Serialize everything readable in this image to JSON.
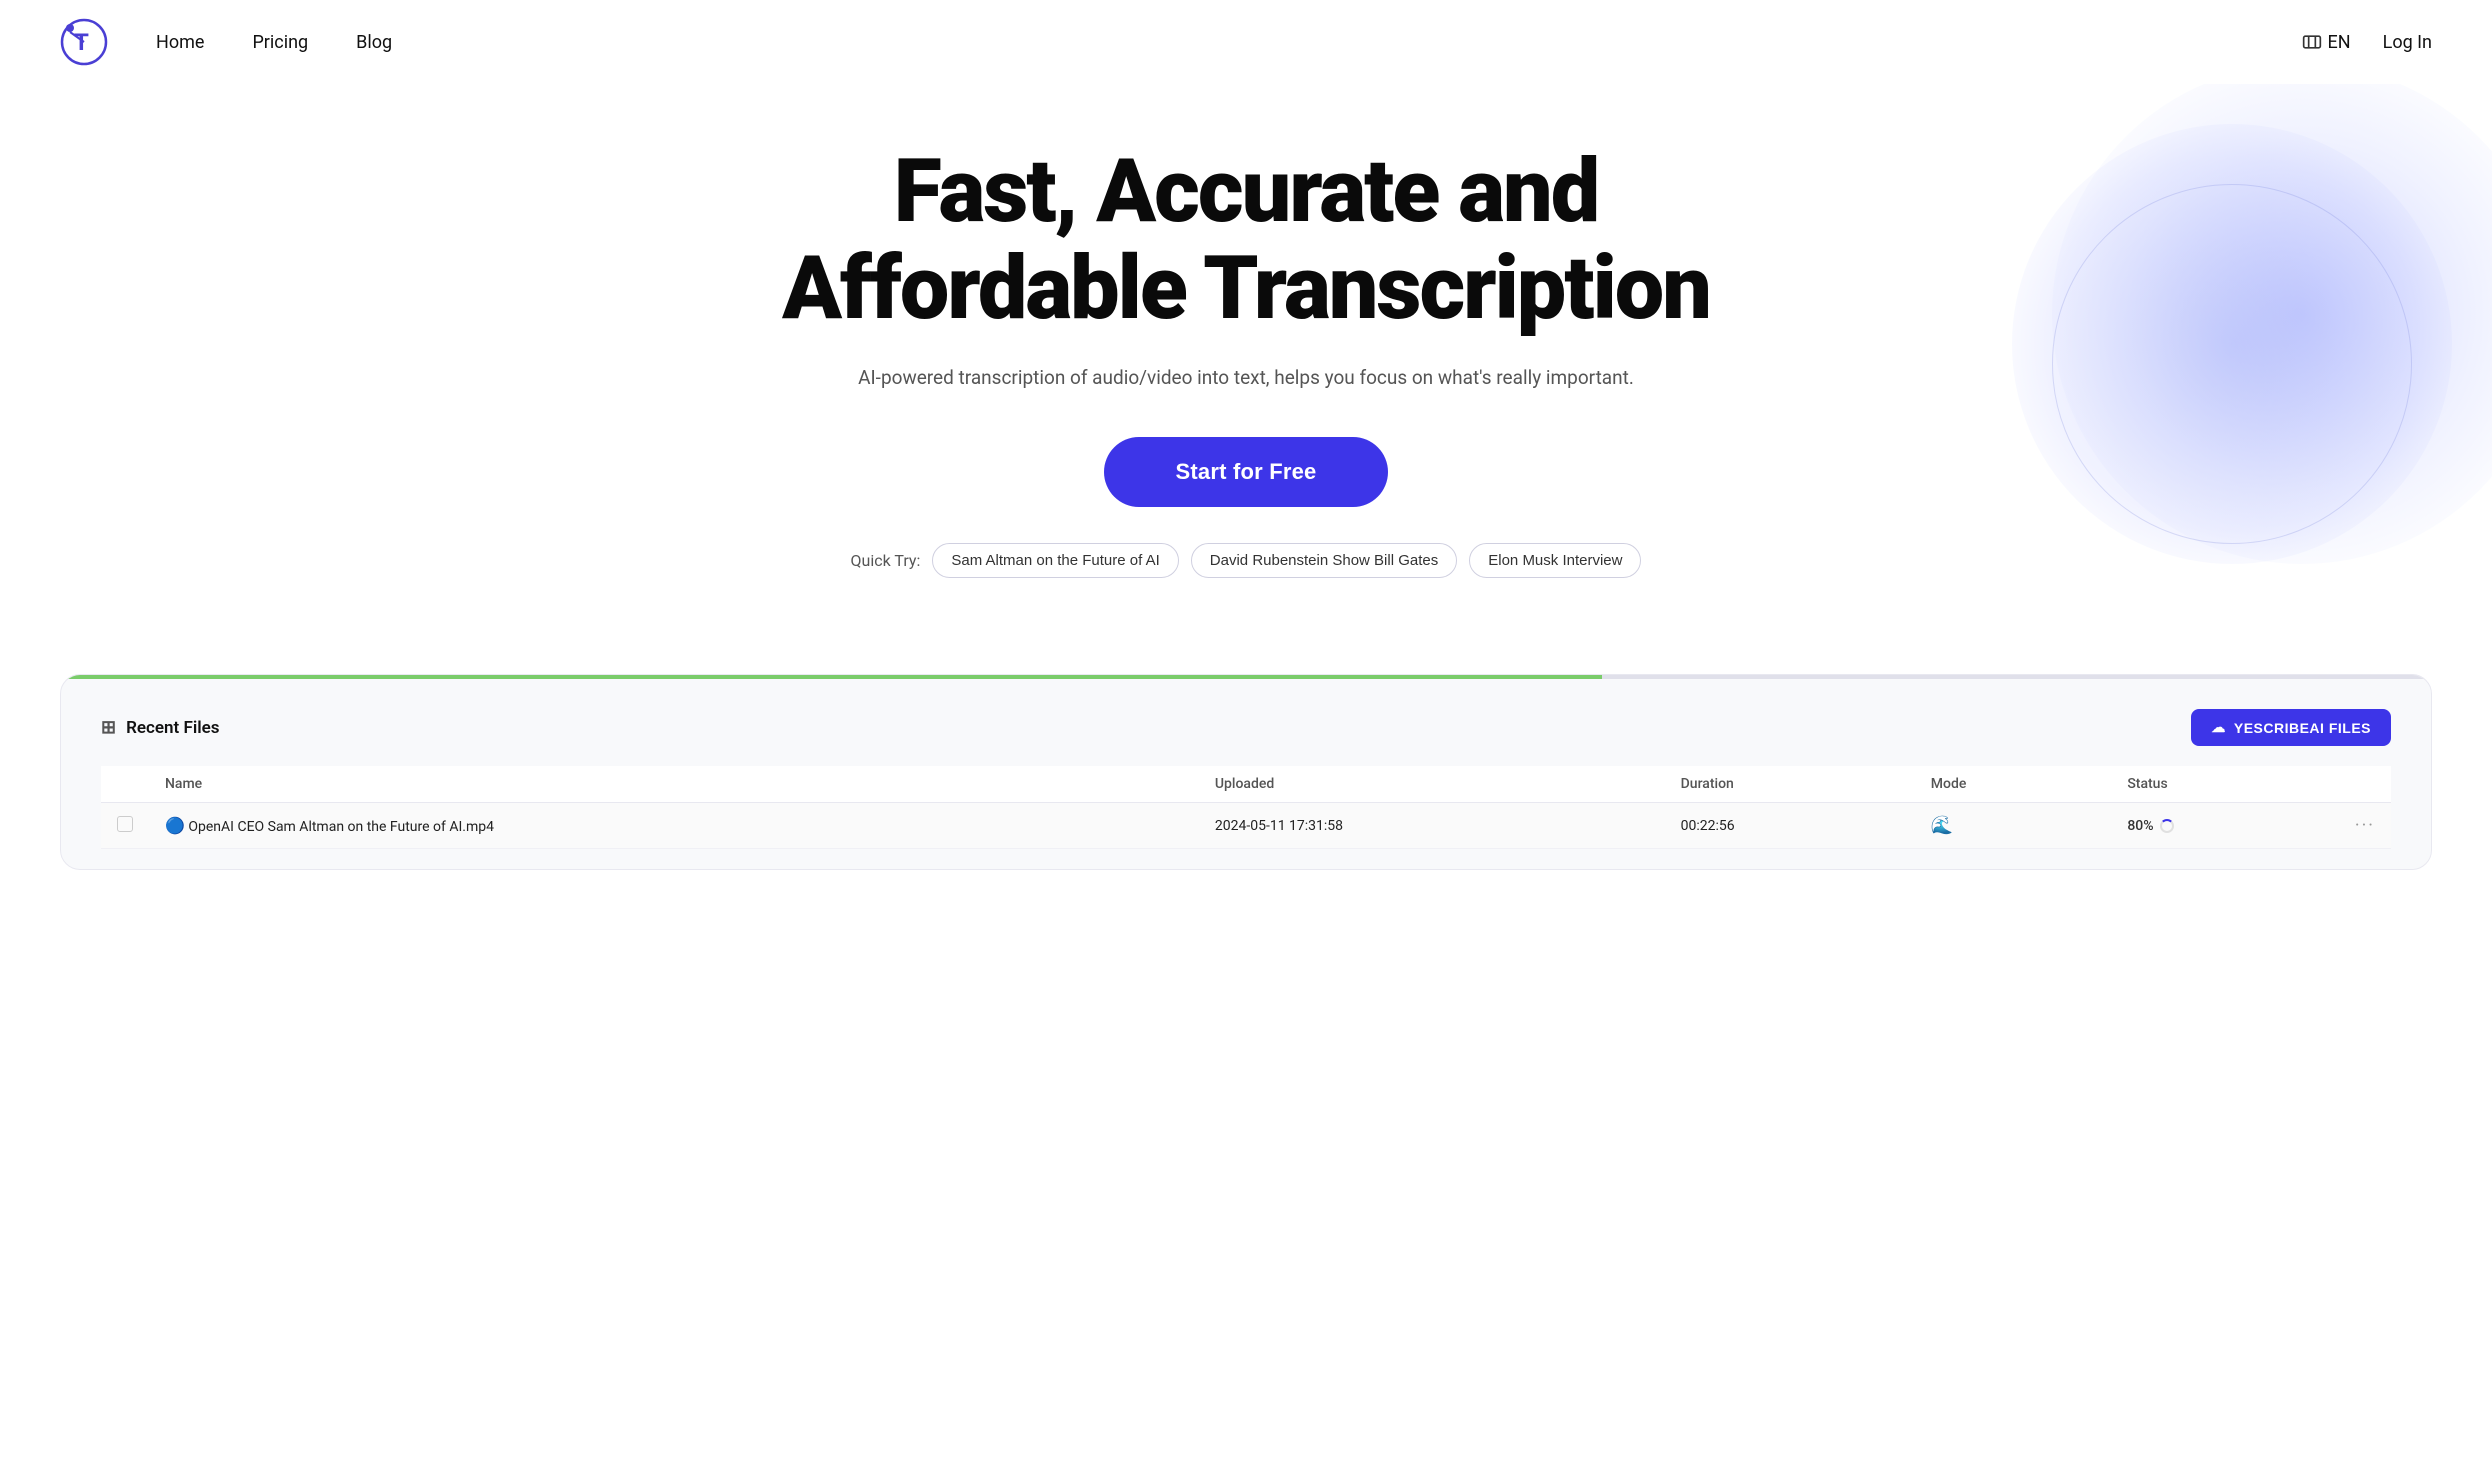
{
  "nav": {
    "home_label": "Home",
    "pricing_label": "Pricing",
    "blog_label": "Blog",
    "lang_label": "EN",
    "login_label": "Log In"
  },
  "hero": {
    "title": "Fast, Accurate and Affordable Transcription",
    "subtitle": "AI-powered transcription of audio/video into text, helps you focus on what's really important.",
    "cta_label": "Start for Free"
  },
  "quick_try": {
    "label": "Quick Try:",
    "chips": [
      "Sam Altman on the Future of AI",
      "David Rubenstein Show Bill Gates",
      "Elon Musk Interview"
    ]
  },
  "demo": {
    "recent_files_label": "Recent Files",
    "upload_btn_label": "YESCRIBEAI FILES",
    "table": {
      "headers": [
        "Name",
        "Uploaded",
        "Duration",
        "Mode",
        "Status"
      ],
      "rows": [
        {
          "name": "OpenAI CEO Sam Altman on the Future of AI.mp4",
          "emoji": "🔵",
          "uploaded": "2024-05-11 17:31:58",
          "duration": "00:22:56",
          "mode": "wave",
          "status": "80%",
          "status_type": "loading"
        }
      ]
    }
  }
}
